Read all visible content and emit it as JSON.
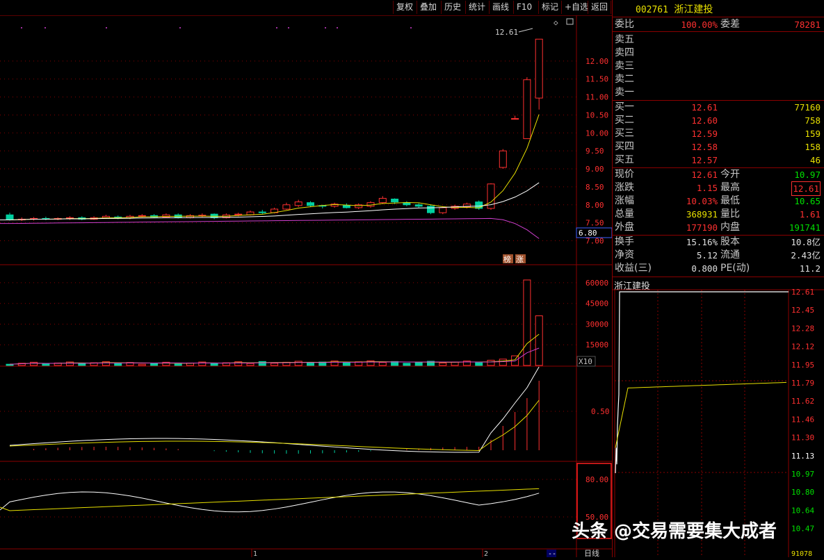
{
  "toolbar": {
    "items": [
      "复权",
      "叠加",
      "历史",
      "统计",
      "画线",
      "F10",
      "标记",
      "+自选",
      "返回"
    ]
  },
  "stock": {
    "code": "002761",
    "name": "浙江建投"
  },
  "orderbook": {
    "weibi_label": "委比",
    "weibi_value": "100.00%",
    "weicha_label": "委差",
    "weicha_value": "78281",
    "asks": [
      {
        "label": "卖五"
      },
      {
        "label": "卖四"
      },
      {
        "label": "卖三"
      },
      {
        "label": "卖二"
      },
      {
        "label": "卖一"
      }
    ],
    "bids": [
      {
        "label": "买一",
        "price": "12.61",
        "vol": "77160"
      },
      {
        "label": "买二",
        "price": "12.60",
        "vol": "758"
      },
      {
        "label": "买三",
        "price": "12.59",
        "vol": "159"
      },
      {
        "label": "买四",
        "price": "12.58",
        "vol": "158"
      },
      {
        "label": "买五",
        "price": "12.57",
        "vol": "46"
      }
    ]
  },
  "quote": {
    "rows": [
      {
        "l1": "现价",
        "v1": "12.61",
        "c1": "red",
        "l2": "今开",
        "v2": "10.97",
        "c2": "grn"
      },
      {
        "l1": "涨跌",
        "v1": "1.15",
        "c1": "red",
        "l2": "最高",
        "v2": "12.61",
        "c2": "red"
      },
      {
        "l1": "涨幅",
        "v1": "10.03%",
        "c1": "red",
        "l2": "最低",
        "v2": "10.65",
        "c2": "grn"
      },
      {
        "l1": "总量",
        "v1": "368931",
        "c1": "yel",
        "l2": "量比",
        "v2": "1.61",
        "c2": "red"
      },
      {
        "l1": "外盘",
        "v1": "177190",
        "c1": "red",
        "l2": "内盘",
        "v2": "191741",
        "c2": "grn"
      }
    ],
    "fund_rows": [
      {
        "l1": "换手",
        "v1": "15.16%",
        "l2": "股本",
        "v2": "10.8亿"
      },
      {
        "l1": "净资",
        "v1": "5.12",
        "l2": "流通",
        "v2": "2.43亿"
      },
      {
        "l1": "收益(三)",
        "v1": "0.800",
        "l2": "PE(动)",
        "v2": "11.2"
      }
    ]
  },
  "intraday": {
    "title": "浙江建投",
    "price_labels": [
      "12.61",
      "12.45",
      "12.28",
      "12.12",
      "11.95",
      "11.79",
      "11.62",
      "11.46",
      "11.30",
      "11.13",
      "10.97",
      "10.80",
      "10.64",
      "10.47"
    ],
    "volume_readout": "91078"
  },
  "kline": {
    "price_axis": [
      "12.00",
      "11.50",
      "11.00",
      "10.50",
      "10.00",
      "9.50",
      "9.00",
      "8.50",
      "8.00",
      "7.50",
      "7.00"
    ],
    "current_price_marker": "6.80",
    "high_annotation": "12.61",
    "volume_axis": [
      "60000",
      "45000",
      "30000",
      "15000"
    ],
    "volume_unit": "X10",
    "indicator_axis": [
      "0.50"
    ],
    "osc_axis": [
      "80.00",
      "50.00"
    ],
    "badges": [
      "榜",
      "涨"
    ],
    "month_marks": [
      "1",
      "2"
    ],
    "period_label": "日线",
    "status_btn": "--"
  },
  "watermark": "头条 @交易需要集大成者",
  "colors": {
    "up": "#ff3030",
    "down": "#00d0a0",
    "ma_yellow": "#e8e000",
    "ma_white": "#ffffff",
    "ma_magenta": "#d040d0",
    "grid": "#8b0000"
  },
  "chart_data": {
    "type": "candlestick",
    "candles_ohlc": [
      [
        7.72,
        7.58,
        7.78,
        7.56
      ],
      [
        7.58,
        7.6,
        7.65,
        7.55
      ],
      [
        7.6,
        7.62,
        7.66,
        7.56
      ],
      [
        7.62,
        7.6,
        7.67,
        7.57
      ],
      [
        7.6,
        7.62,
        7.65,
        7.57
      ],
      [
        7.62,
        7.64,
        7.68,
        7.58
      ],
      [
        7.64,
        7.6,
        7.68,
        7.57
      ],
      [
        7.6,
        7.64,
        7.68,
        7.58
      ],
      [
        7.64,
        7.68,
        7.72,
        7.61
      ],
      [
        7.66,
        7.63,
        7.7,
        7.6
      ],
      [
        7.63,
        7.68,
        7.72,
        7.6
      ],
      [
        7.68,
        7.7,
        7.74,
        7.65
      ],
      [
        7.7,
        7.66,
        7.74,
        7.63
      ],
      [
        7.66,
        7.72,
        7.76,
        7.64
      ],
      [
        7.72,
        7.64,
        7.76,
        7.62
      ],
      [
        7.64,
        7.7,
        7.74,
        7.62
      ],
      [
        7.7,
        7.71,
        7.76,
        7.66
      ],
      [
        7.74,
        7.64,
        7.76,
        7.6
      ],
      [
        7.64,
        7.72,
        7.76,
        7.62
      ],
      [
        7.72,
        7.74,
        7.78,
        7.68
      ],
      [
        7.72,
        7.8,
        7.84,
        7.7
      ],
      [
        7.8,
        7.78,
        7.86,
        7.74
      ],
      [
        7.78,
        7.88,
        7.92,
        7.76
      ],
      [
        7.88,
        8.0,
        8.06,
        7.86
      ],
      [
        7.98,
        8.08,
        8.14,
        7.94
      ],
      [
        8.06,
        7.98,
        8.1,
        7.94
      ],
      [
        7.98,
        7.96,
        8.0,
        7.9
      ],
      [
        7.96,
        8.02,
        8.06,
        7.92
      ],
      [
        7.98,
        7.92,
        8.04,
        7.9
      ],
      [
        7.92,
        8.0,
        8.04,
        7.88
      ],
      [
        7.96,
        8.06,
        8.1,
        7.92
      ],
      [
        8.06,
        8.18,
        8.24,
        8.02
      ],
      [
        8.16,
        8.08,
        8.18,
        8.02
      ],
      [
        8.06,
        8.0,
        8.1,
        7.96
      ],
      [
        8.0,
        7.96,
        8.04,
        7.92
      ],
      [
        7.96,
        7.78,
        8.0,
        7.74
      ],
      [
        7.78,
        7.92,
        7.96,
        7.74
      ],
      [
        7.9,
        7.96,
        8.0,
        7.86
      ],
      [
        7.94,
        8.02,
        8.06,
        7.9
      ],
      [
        8.08,
        7.9,
        8.12,
        7.86
      ],
      [
        7.9,
        8.58,
        8.6,
        7.86
      ],
      [
        9.04,
        9.5,
        9.55,
        9.0
      ],
      [
        10.4,
        10.4,
        10.48,
        10.4
      ],
      [
        9.84,
        11.48,
        11.55,
        9.84
      ],
      [
        10.97,
        12.61,
        12.61,
        10.65
      ]
    ],
    "high_label": 12.61,
    "ylim": [
      6.7,
      12.5
    ],
    "volume_ylim": [
      0,
      65000
    ]
  }
}
